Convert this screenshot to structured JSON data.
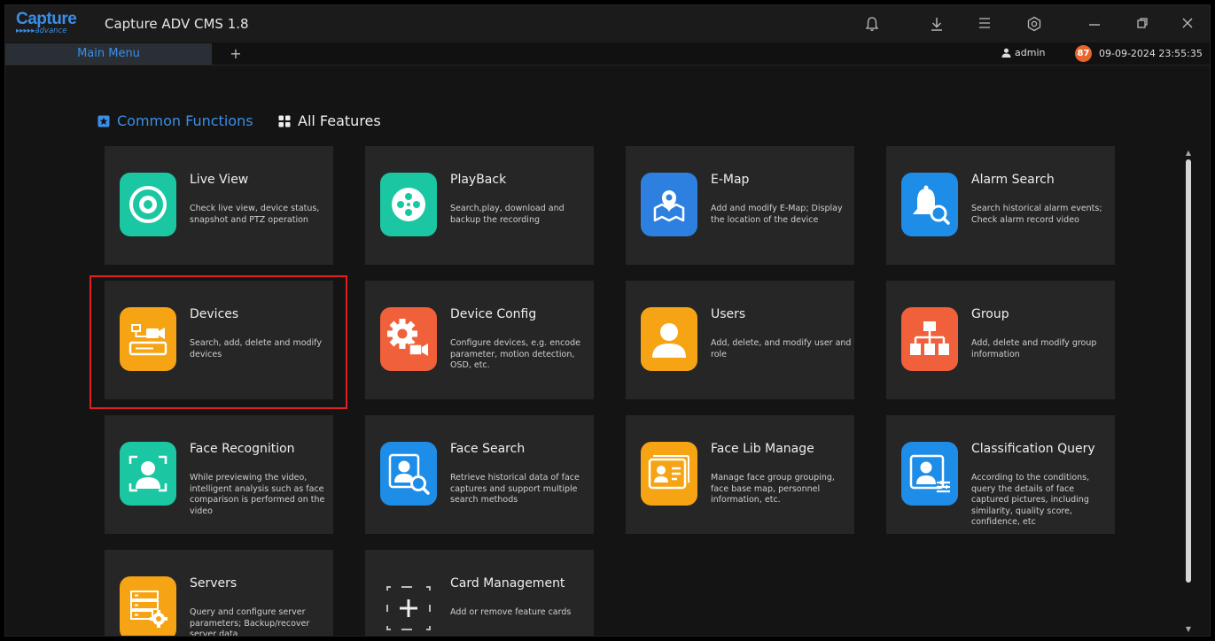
{
  "app": {
    "logo_top": "Capture",
    "logo_bottom": "▸▸▸▸▸advance",
    "title": "Capture ADV CMS 1.8"
  },
  "toolbar_icons": [
    "bell-icon",
    "download-icon",
    "menu-icon",
    "settings-icon",
    "minimize-icon",
    "restore-icon",
    "close-icon"
  ],
  "tabs": {
    "main_label": "Main Menu",
    "add_label": "+"
  },
  "status": {
    "user": "admin",
    "badge": "87",
    "datetime": "09-09-2024 23:55:35"
  },
  "sections": {
    "common": "Common Functions",
    "all": "All Features"
  },
  "cards": [
    {
      "title": "Live View",
      "desc": "Check live view, device status, snapshot and PTZ operation",
      "icon": "live-view-icon",
      "color": "#1bc7a3"
    },
    {
      "title": "PlayBack",
      "desc": "Search,play, download and backup the recording",
      "icon": "playback-icon",
      "color": "#1bc7a3"
    },
    {
      "title": "E-Map",
      "desc": "Add and modify E-Map; Display the location of the device",
      "icon": "map-pin-icon",
      "color": "#2d7fe0"
    },
    {
      "title": "Alarm Search",
      "desc": "Search historical alarm events; Check alarm record video",
      "icon": "alarm-bell-icon",
      "color": "#1e8de8"
    },
    {
      "title": "Devices",
      "desc": "Search, add, delete and modify devices",
      "icon": "devices-icon",
      "color": "#f6a414"
    },
    {
      "title": "Device Config",
      "desc": "Configure devices, e.g. encode parameter, motion detection, OSD, etc.",
      "icon": "device-config-icon",
      "color": "#f0603a"
    },
    {
      "title": "Users",
      "desc": "Add, delete, and modify user and role",
      "icon": "user-icon",
      "color": "#f6a414"
    },
    {
      "title": "Group",
      "desc": "Add, delete and modify group information",
      "icon": "group-icon",
      "color": "#f0603a"
    },
    {
      "title": "Face Recognition",
      "desc": "While previewing the video, intelligent analysis such as face comparison is performed on the video",
      "icon": "face-recognition-icon",
      "color": "#1bc7a3"
    },
    {
      "title": "Face Search",
      "desc": "Retrieve historical data of face captures and support multiple search methods",
      "icon": "face-search-icon",
      "color": "#1e8de8"
    },
    {
      "title": "Face Lib Manage",
      "desc": "Manage face group grouping, face base map, personnel information, etc.",
      "icon": "face-lib-icon",
      "color": "#f6a414"
    },
    {
      "title": "Classification Query",
      "desc": "According to the conditions, query the details of face captured pictures, including similarity, quality score, confidence, etc",
      "icon": "classification-icon",
      "color": "#1e8de8"
    },
    {
      "title": "Servers",
      "desc": "Query and configure server parameters; Backup/recover server data",
      "icon": "server-icon",
      "color": "#f6a414"
    },
    {
      "title": "Card Management",
      "desc": "Add or remove feature cards",
      "icon": "card-add-icon",
      "color": "transparent"
    }
  ]
}
